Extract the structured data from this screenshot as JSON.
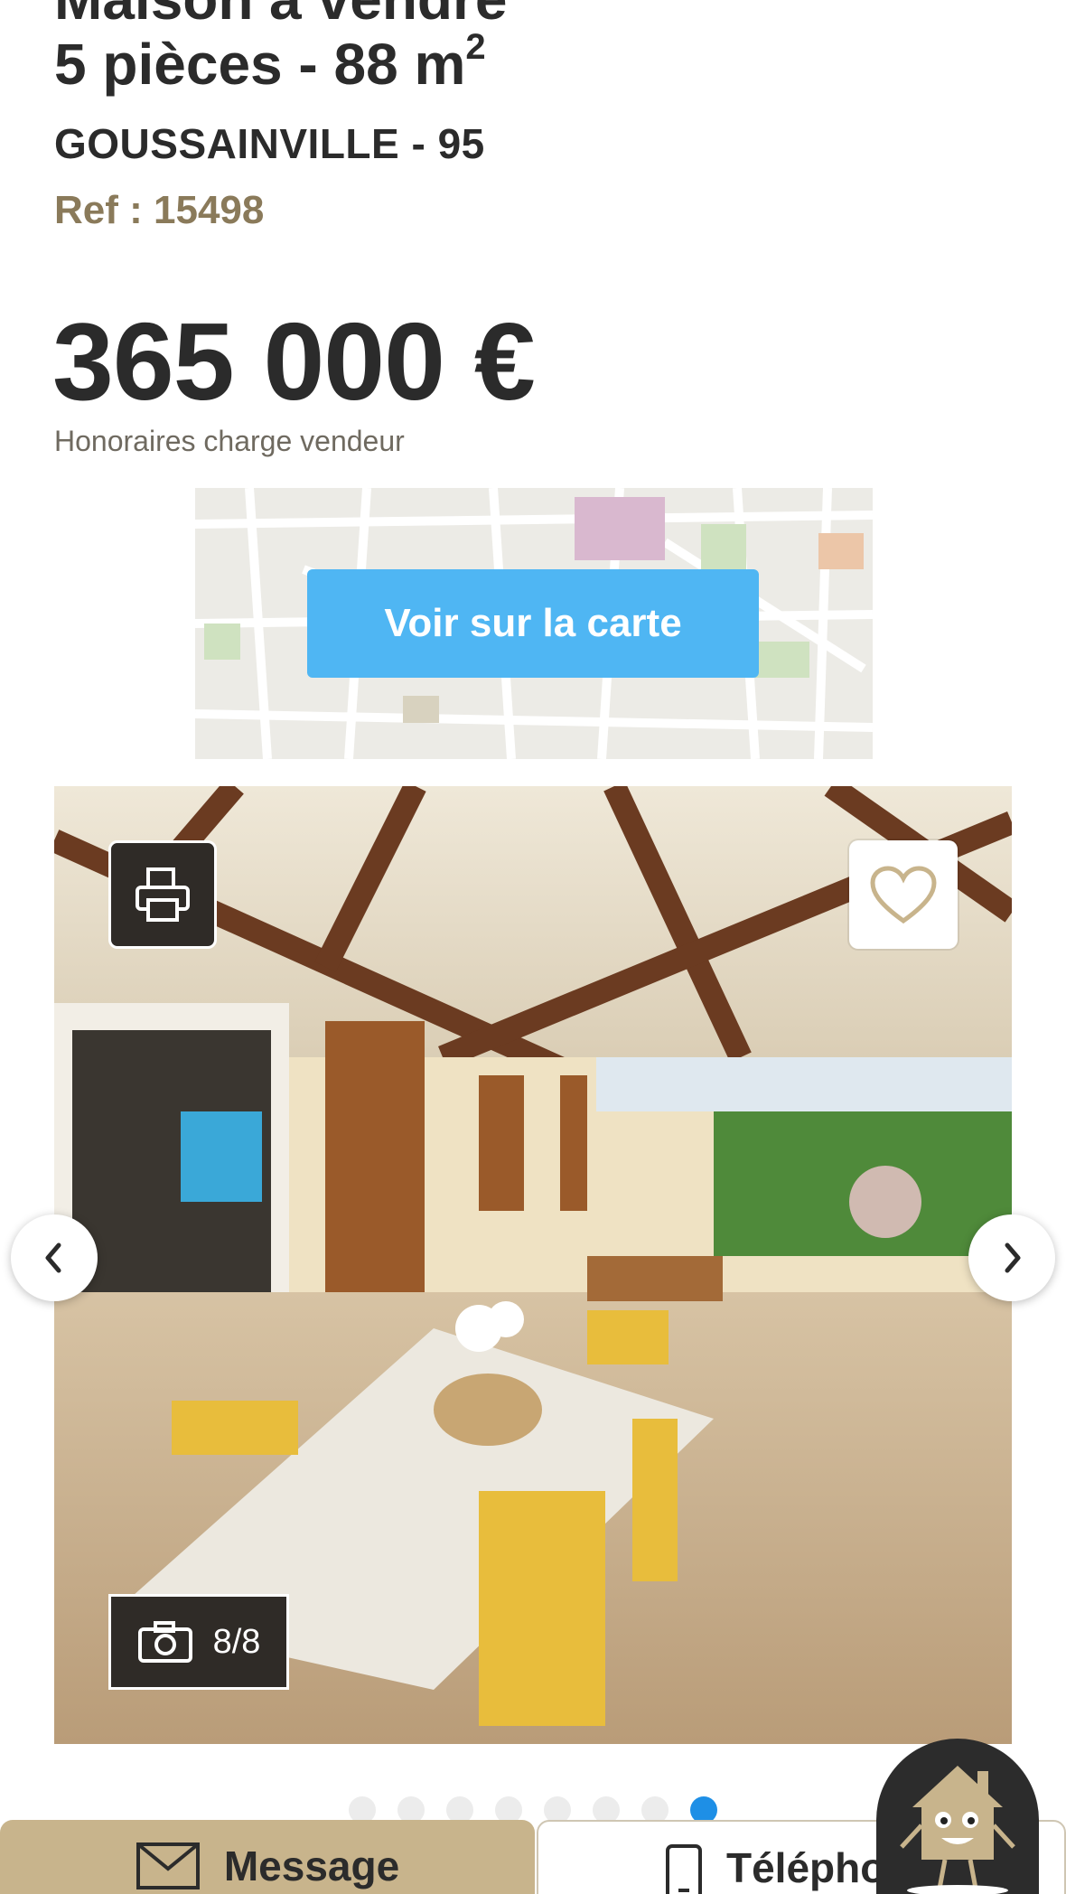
{
  "listing": {
    "title_partial": "Maison à vendre",
    "title_rooms_area": "5 pièces - 88 m",
    "title_area_sup": "2",
    "location": "GOUSSAINVILLE - 95",
    "ref": "Ref : 15498",
    "price": "365 000 €",
    "fees": "Honoraires charge vendeur"
  },
  "map": {
    "button_label": "Voir sur la carte"
  },
  "gallery": {
    "counter": "8/8",
    "current": 8,
    "total": 8
  },
  "contact": {
    "message_label": "Message",
    "phone_label": "Téléphone"
  },
  "colors": {
    "accent_gold": "#c8b48c",
    "map_button": "#4fb6f3",
    "active_dot": "#1e8fe6"
  },
  "icons": [
    "printer-icon",
    "heart-icon",
    "camera-icon",
    "chevron-left-icon",
    "chevron-right-icon",
    "envelope-icon",
    "phone-icon",
    "mascot-house-icon"
  ]
}
